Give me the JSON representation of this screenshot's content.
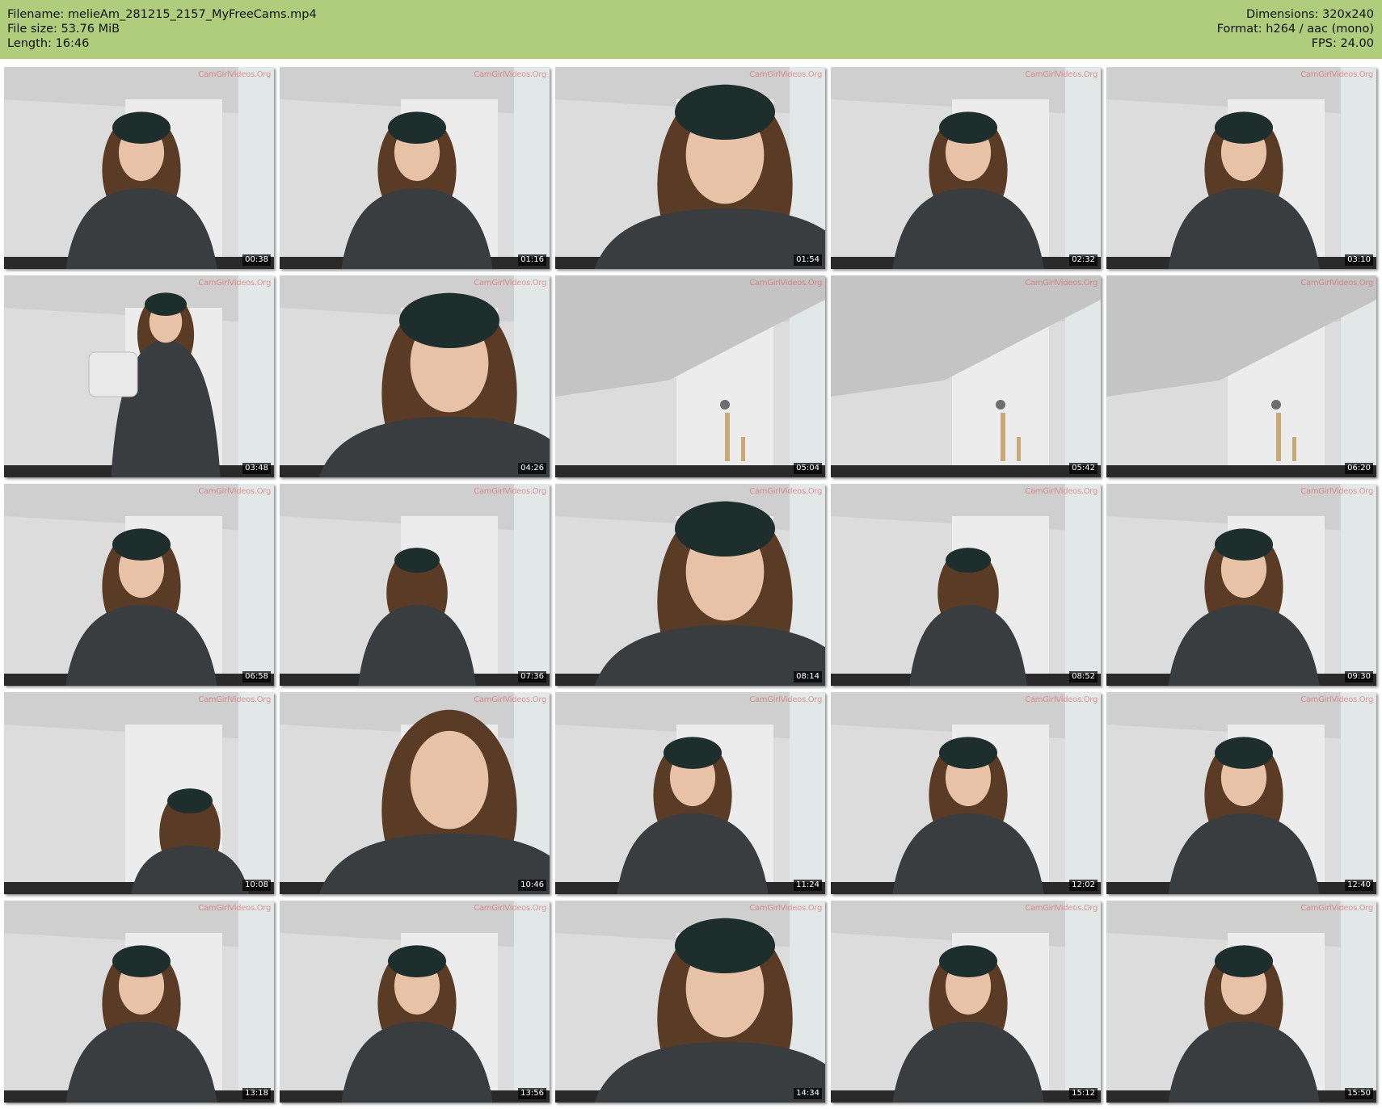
{
  "header": {
    "filename_line": "Filename: melieAm_281215_2157_MyFreeCams.mp4",
    "filesize_line": "File size: 53.76 MiB",
    "length_line": "Length: 16:46",
    "dimensions_line": "Dimensions: 320x240",
    "format_line": "Format: h264 / aac (mono)",
    "fps_line": "FPS: 24.00",
    "background_color": "#b0cd7d"
  },
  "watermark": "CamGirlVideos.Org",
  "thumbnails": [
    {
      "time": "00:38",
      "scene": "person"
    },
    {
      "time": "01:16",
      "scene": "person"
    },
    {
      "time": "01:54",
      "scene": "person-close"
    },
    {
      "time": "02:32",
      "scene": "person"
    },
    {
      "time": "03:10",
      "scene": "person"
    },
    {
      "time": "03:48",
      "scene": "person-bag"
    },
    {
      "time": "04:26",
      "scene": "person-close"
    },
    {
      "time": "05:04",
      "scene": "room"
    },
    {
      "time": "05:42",
      "scene": "room"
    },
    {
      "time": "06:20",
      "scene": "room"
    },
    {
      "time": "06:58",
      "scene": "person"
    },
    {
      "time": "07:36",
      "scene": "person-side"
    },
    {
      "time": "08:14",
      "scene": "person-close"
    },
    {
      "time": "08:52",
      "scene": "person-side"
    },
    {
      "time": "09:30",
      "scene": "person"
    },
    {
      "time": "10:08",
      "scene": "person-low"
    },
    {
      "time": "10:46",
      "scene": "face-close"
    },
    {
      "time": "11:24",
      "scene": "person"
    },
    {
      "time": "12:02",
      "scene": "person"
    },
    {
      "time": "12:40",
      "scene": "person"
    },
    {
      "time": "13:18",
      "scene": "person"
    },
    {
      "time": "13:56",
      "scene": "person"
    },
    {
      "time": "14:34",
      "scene": "person-close"
    },
    {
      "time": "15:12",
      "scene": "person"
    },
    {
      "time": "15:50",
      "scene": "person"
    }
  ]
}
